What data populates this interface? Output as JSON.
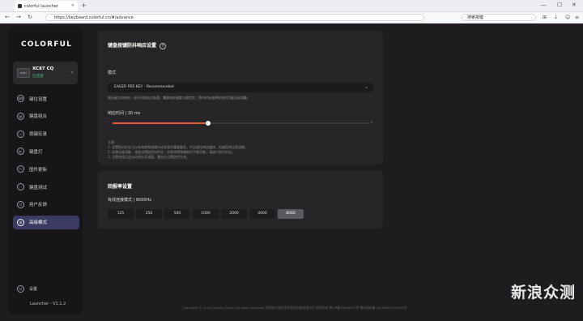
{
  "browser": {
    "tab_title": "colorful launcher",
    "url": "https://keyboard.colorful.cn/#/advance",
    "search_placeholder": "搜索按键"
  },
  "sidebar": {
    "logo": "COLORFUL",
    "device": {
      "name": "XC87 CQ",
      "status": "已连接",
      "img_label": "XC87"
    },
    "items": [
      {
        "label": "键位设置",
        "icon": "⌨"
      },
      {
        "label": "键盘组合",
        "icon": "▦"
      },
      {
        "label": "按键宏录",
        "icon": "⌂"
      },
      {
        "label": "键盘灯",
        "icon": "◐"
      },
      {
        "label": "固件更新",
        "icon": "↻"
      },
      {
        "label": "键盘测试",
        "icon": "✓"
      },
      {
        "label": "用户反馈",
        "icon": "✉"
      },
      {
        "label": "高级模式",
        "icon": "⚙"
      }
    ],
    "active_index": 7,
    "settings_label": "设置",
    "version": "Launcher - V1.1.2"
  },
  "response_card": {
    "title": "键盘按键防抖响应设置",
    "mode_label": "模式",
    "mode_value": "EAGER PER KEY - Recommended",
    "mode_desc": "按压键立刻响应，松开时再去抖处理，兼顾响应速度与稳定性；防抖时长选择较短时可能出现误触。",
    "delay_label": "响应时间 | 30 ms",
    "slider_min_symbol": "-",
    "slider_max_symbol": "+",
    "slider_fraction": 0.37,
    "notes": [
      "注意：",
      "1. 设置防抖时长可以有效避免按键抖动导致的重复触发，时长越短响应越快，但越容易出现误触。",
      "2. 如果出现误触，请尝试增加防抖时长；如果觉得按键响应不够灵敏，请减少防抖时长。",
      "3. 设置完成后会自动保存至键盘，重启后设置依然生效。"
    ]
  },
  "polling_card": {
    "title": "回报率设置",
    "mode_label": "有线连接模式 | 8000Hz",
    "rates": [
      "125",
      "250",
      "500",
      "1000",
      "2000",
      "4000",
      "8000"
    ],
    "selected_index": 6
  },
  "footer": "Copyright © 2016 Colorful CoLtd. All rights reserved. 深圳市七彩虹禹贡科技发展有限公司 版权所有 粤ICP备15006057号   粤公网安备 44030602000038号",
  "watermark": "新浪众测",
  "colors": {
    "accent": "#e45a3c",
    "active_nav": "#3a3a62",
    "connected": "#3fc47a"
  }
}
